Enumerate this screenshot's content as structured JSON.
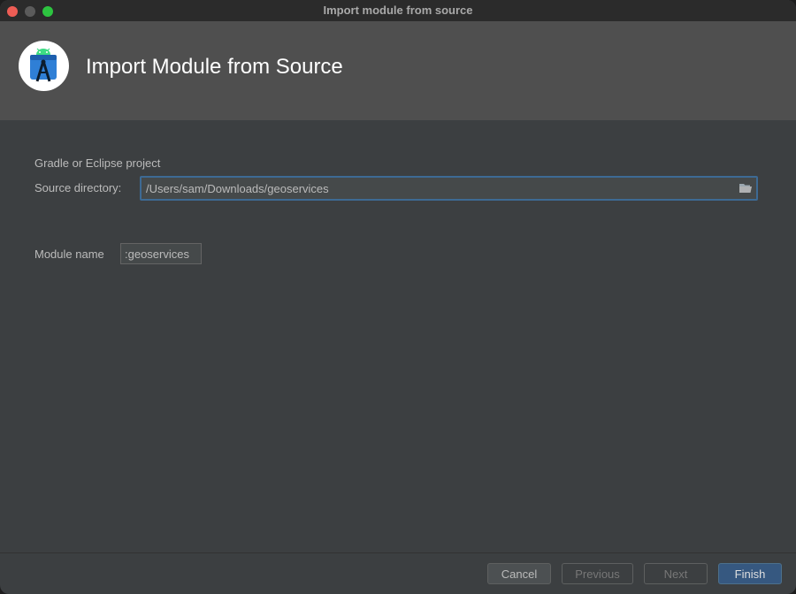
{
  "window": {
    "title": "Import module from source"
  },
  "header": {
    "title": "Import Module from Source",
    "icon": "android-studio-icon"
  },
  "form": {
    "section_label": "Gradle or Eclipse project",
    "source_label": "Source directory:",
    "source_value": "/Users/sam/Downloads/geoservices",
    "browse_icon": "folder-icon",
    "module_label": "Module name",
    "module_value": ":geoservices"
  },
  "footer": {
    "cancel": "Cancel",
    "previous": "Previous",
    "next": "Next",
    "finish": "Finish"
  },
  "colors": {
    "background": "#3c3f41",
    "header": "#4f4f4f",
    "focus_border": "#3d6a94",
    "primary_button": "#365880"
  }
}
